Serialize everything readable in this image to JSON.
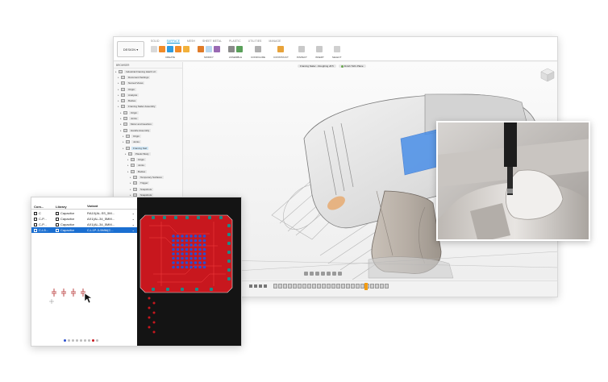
{
  "colors": {
    "accent": "#0696d7",
    "pcb_red": "#c8171e",
    "pcb_blue": "#2a4fd0",
    "pcb_teal": "#1e8a86",
    "selection": "#1b6fd1",
    "tool_highlight": "#2e7be0"
  },
  "cad": {
    "workspace_label": "DESIGN",
    "tabs": [
      "SOLID",
      "SURFACE",
      "MESH",
      "SHEET METAL",
      "PLASTIC",
      "UTILITIES",
      "MANAGE"
    ],
    "active_tab": "SURFACE",
    "groups": [
      "CREATE",
      "MODIFY",
      "ASSEMBLE",
      "CONFIGURE",
      "CONSTRUCT",
      "INSPECT",
      "INSERT",
      "SELECT"
    ],
    "browser_title": "BROWSER",
    "browser_items": [
      "Industrial Framing Hatch v3",
      "Document Settings",
      "Named Views",
      "Origin",
      "Analysis",
      "Bodies",
      "Framing Nailer Assembly",
      "Origin",
      "Joints",
      "Motor and Gearbox",
      "Handle Assembly",
      "Origin",
      "Joints",
      "Framing Nail",
      "Plastic Body",
      "Origin",
      "Joints",
      "Bodies",
      "Temporary Surfaces",
      "Trigger",
      "Snapshots",
      "Snapshots"
    ],
    "doc_tabs": [
      "Framing Nailer - Roughing v8.5",
      "Finish Toll's Plane"
    ],
    "comments_label": "COMMENTS"
  },
  "pcb": {
    "columns": [
      "Com...",
      "Library",
      "Variant"
    ],
    "rows": [
      {
        "comp": "C",
        "lib": "Capacitor",
        "variant": "RA10(AL-SS_5M..."
      },
      {
        "comp": "C-P...",
        "lib": "Capacitor",
        "variant": "AX1(AL-34_5MM..."
      },
      {
        "comp": "C-P...",
        "lib": "Capacitor",
        "variant": "AX1(AL-34_5MM..."
      },
      {
        "comp": "C-L5...",
        "lib": "Capacitor",
        "variant": "C-L1P-3-5MM(C..."
      }
    ],
    "selected_row": 3
  }
}
